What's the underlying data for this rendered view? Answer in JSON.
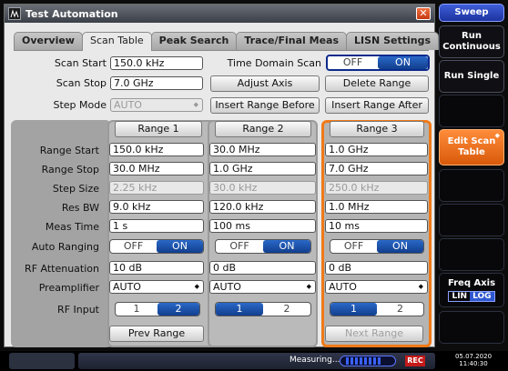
{
  "window": {
    "title": "Test Automation",
    "close": "✕"
  },
  "tabs": [
    "Overview",
    "Scan Table",
    "Peak Search",
    "Trace/Final Meas",
    "LISN Settings"
  ],
  "scan": {
    "start_label": "Scan Start",
    "start_value": "150.0 kHz",
    "stop_label": "Scan Stop",
    "stop_value": "7.0 GHz",
    "step_mode_label": "Step Mode",
    "step_mode_value": "AUTO",
    "time_domain_label": "Time Domain Scan",
    "time_domain_off": "OFF",
    "time_domain_on": "ON",
    "adjust_axis": "Adjust Axis",
    "delete_range": "Delete Range",
    "insert_before": "Insert Range Before",
    "insert_after": "Insert Range After"
  },
  "row_labels": [
    "Range Start",
    "Range Stop",
    "Step Size",
    "Res BW",
    "Meas Time",
    "Auto Ranging",
    "RF Attenuation",
    "Preamplifier",
    "RF Input"
  ],
  "ranges": [
    {
      "name": "Range 1",
      "start": "150.0 kHz",
      "stop": "30.0 MHz",
      "step": "2.25 kHz",
      "rbw": "9.0 kHz",
      "meas_time": "1 s",
      "auto_off": "OFF",
      "auto_on": "ON",
      "atten": "10 dB",
      "preamp": "AUTO",
      "in1": "1",
      "in2": "2"
    },
    {
      "name": "Range 2",
      "start": "30.0 MHz",
      "stop": "1.0 GHz",
      "step": "30.0 kHz",
      "rbw": "120.0 kHz",
      "meas_time": "100 ms",
      "auto_off": "OFF",
      "auto_on": "ON",
      "atten": "0 dB",
      "preamp": "AUTO",
      "in1": "1",
      "in2": "2"
    },
    {
      "name": "Range 3",
      "start": "1.0 GHz",
      "stop": "7.0 GHz",
      "step": "250.0 kHz",
      "rbw": "1.0 MHz",
      "meas_time": "10 ms",
      "auto_off": "OFF",
      "auto_on": "ON",
      "atten": "0 dB",
      "preamp": "AUTO",
      "in1": "1",
      "in2": "2"
    }
  ],
  "prev_range": "Prev Range",
  "next_range": "Next Range",
  "softkeys": {
    "header": "Sweep",
    "run_continuous": "Run Continuous",
    "run_single": "Run Single",
    "edit_scan_table": "Edit Scan Table",
    "freq_axis": "Freq Axis",
    "lin": "LIN",
    "log": "LOG"
  },
  "status": {
    "measuring": "Measuring...",
    "date": "05.07.2020",
    "time": "11:40:30"
  },
  "colors": {
    "accent": "#f07a18",
    "toggle_on": "#1d4ea8",
    "header": "#2e48c0"
  }
}
